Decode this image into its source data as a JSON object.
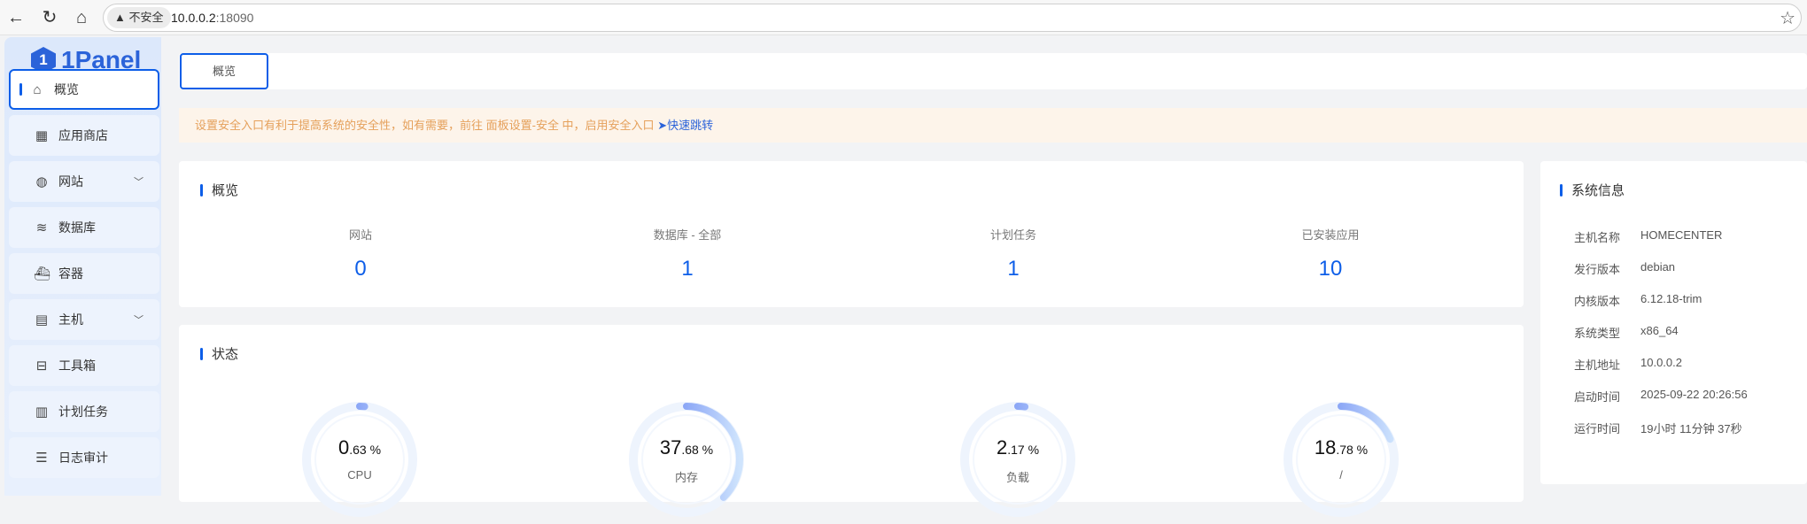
{
  "browser": {
    "security_label": "不安全",
    "url_host": "10.0.0.2",
    "url_port": ":18090"
  },
  "sidebar": {
    "logo": "1Panel",
    "logo_mark": "1",
    "items": [
      {
        "label": "概览",
        "icon": "home-icon"
      },
      {
        "label": "应用商店",
        "icon": "grid-icon"
      },
      {
        "label": "网站",
        "icon": "globe-icon"
      },
      {
        "label": "数据库",
        "icon": "layers-icon"
      },
      {
        "label": "容器",
        "icon": "docker-icon"
      },
      {
        "label": "主机",
        "icon": "server-icon"
      },
      {
        "label": "工具箱",
        "icon": "toolbox-icon"
      },
      {
        "label": "计划任务",
        "icon": "calendar-icon"
      },
      {
        "label": "日志审计",
        "icon": "log-icon"
      }
    ]
  },
  "tabs": {
    "active": "概览"
  },
  "banner": {
    "text": "设置安全入口有利于提高系统的安全性，如有需要，前往 面板设置-安全 中，启用安全入口",
    "link": "快速跳转"
  },
  "overview": {
    "title": "概览",
    "stats": [
      {
        "label": "网站",
        "value": "0"
      },
      {
        "label": "数据库 - 全部",
        "value": "1"
      },
      {
        "label": "计划任务",
        "value": "1"
      },
      {
        "label": "已安装应用",
        "value": "10"
      }
    ]
  },
  "status": {
    "title": "状态",
    "gauges": [
      {
        "int": "0",
        "dec": ".63 %",
        "label": "CPU",
        "percent": 0.63
      },
      {
        "int": "37",
        "dec": ".68 %",
        "label": "内存",
        "percent": 37.68
      },
      {
        "int": "2",
        "dec": ".17 %",
        "label": "负载",
        "percent": 2.17
      },
      {
        "int": "18",
        "dec": ".78 %",
        "label": "/",
        "percent": 18.78
      }
    ]
  },
  "sysinfo": {
    "title": "系统信息",
    "rows": [
      {
        "k": "主机名称",
        "v": "HOMECENTER"
      },
      {
        "k": "发行版本",
        "v": "debian"
      },
      {
        "k": "内核版本",
        "v": "6.12.18-trim"
      },
      {
        "k": "系统类型",
        "v": "x86_64"
      },
      {
        "k": "主机地址",
        "v": "10.0.0.2"
      },
      {
        "k": "启动时间",
        "v": "2025-09-22 20:26:56"
      },
      {
        "k": "运行时间",
        "v": "19小时 11分钟 37秒"
      }
    ]
  }
}
